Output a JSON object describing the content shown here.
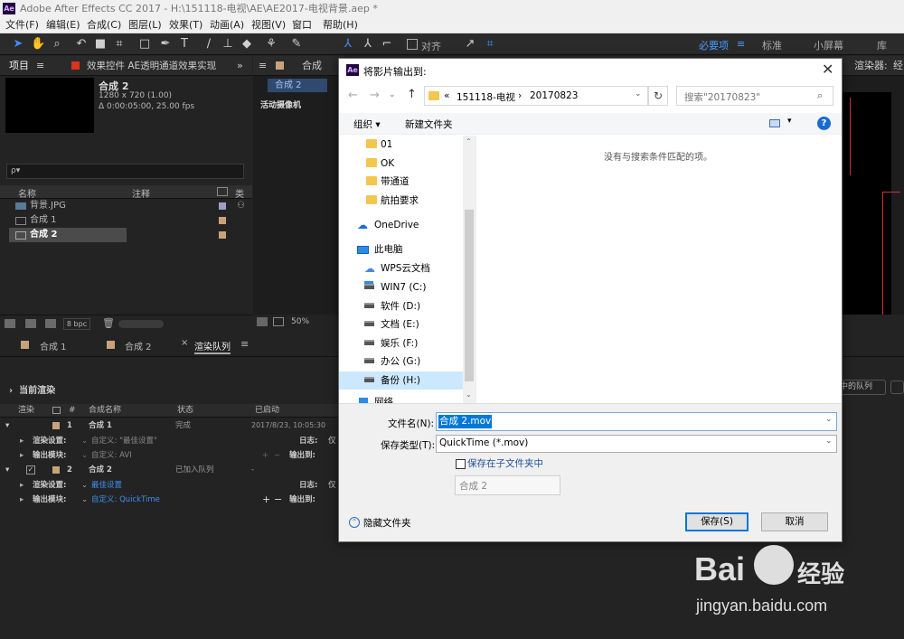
{
  "window": {
    "title": "Adobe After Effects CC 2017 - H:\\151118-电视\\AE\\AE2017-电视背景.aep *",
    "logo": "Ae"
  },
  "menu": [
    "文件(F)",
    "编辑(E)",
    "合成(C)",
    "图层(L)",
    "效果(T)",
    "动画(A)",
    "视图(V)",
    "窗口",
    "帮助(H)"
  ],
  "toolbar": {
    "align_label": "对齐",
    "workspaces": [
      "必要项",
      "标准",
      "小屏幕",
      "库"
    ]
  },
  "project": {
    "tab": "项目",
    "tab2": "效果控件 AE透明通道效果实现",
    "selected_name": "合成 2",
    "selected_info": "1280 x 720 (1.00)",
    "selected_duration": "Δ 0:00:05:00, 25.00 fps",
    "search_placeholder": "ρ▾",
    "columns": [
      "名称",
      "注释",
      "类"
    ],
    "items": [
      {
        "name": "背景.JPG",
        "color": "#9d9dcf"
      },
      {
        "name": "合成 1",
        "color": "#c8a37a"
      },
      {
        "name": "合成 2",
        "color": "#c8a37a"
      }
    ],
    "bpc": "8 bpc"
  },
  "composition": {
    "tab": "合成",
    "tab_label": "合成 2",
    "camera": "活动摄像机",
    "zoom": "50%",
    "renderer": "渲染器:",
    "renderer_value": "经"
  },
  "timeline": {
    "tabs": [
      "合成 1",
      "合成 2",
      "渲染队列"
    ],
    "current_render": "当前渲染",
    "queue_btn": "中的队列",
    "columns": [
      "渲染",
      "#",
      "合成名称",
      "状态",
      "已启动"
    ],
    "items": [
      {
        "num": "1",
        "name": "合成 1",
        "status": "完成",
        "started": "2017/8/23, 10:05:30",
        "log": "日志:",
        "log_val": "仅",
        "render_label": "渲染设置:",
        "render_val": "自定义: \"最佳设置\"",
        "output_label": "输出模块:",
        "output_val": "自定义: AVI",
        "output_to": "输出到:"
      },
      {
        "num": "2",
        "name": "合成 2",
        "status": "已加入队列",
        "started": "-",
        "log": "日志:",
        "log_val": "仅",
        "render_label": "渲染设置:",
        "render_val": "最佳设置",
        "output_label": "输出模块:",
        "output_val": "自定义: QuickTime",
        "output_to": "输出到:"
      }
    ]
  },
  "dialog": {
    "title": "将影片输出到:",
    "logo": "Ae",
    "breadcrumb": [
      "«",
      "151118-电视",
      "›",
      "20170823"
    ],
    "search_placeholder": "搜索\"20170823\"",
    "organize": "组织 ▾",
    "new_folder": "新建文件夹",
    "empty_message": "没有与搜索条件匹配的项。",
    "tree": [
      {
        "label": "01",
        "type": "folder"
      },
      {
        "label": "OK",
        "type": "folder"
      },
      {
        "label": "带通道",
        "type": "folder"
      },
      {
        "label": "航拍要求",
        "type": "folder"
      },
      {
        "label": "OneDrive",
        "type": "cloud"
      },
      {
        "label": "此电脑",
        "type": "pc"
      },
      {
        "label": "WPS云文档",
        "type": "cloud2"
      },
      {
        "label": "WIN7 (C:)",
        "type": "drive"
      },
      {
        "label": "软件 (D:)",
        "type": "drive"
      },
      {
        "label": "文档 (E:)",
        "type": "drive"
      },
      {
        "label": "娱乐 (F:)",
        "type": "drive"
      },
      {
        "label": "办公 (G:)",
        "type": "drive"
      },
      {
        "label": "备份 (H:)",
        "type": "drive"
      },
      {
        "label": "网络",
        "type": "net"
      }
    ],
    "filename_label": "文件名(N):",
    "filename_value": "合成 2.mov",
    "filetype_label": "保存类型(T):",
    "filetype_value": "QuickTime (*.mov)",
    "subfolder_label": "保存在子文件夹中",
    "subfolder_value": "合成 2",
    "hide_folders": "隐藏文件夹",
    "save": "保存(S)",
    "cancel": "取消"
  },
  "watermark": {
    "text": "Bai",
    "text2": "经验",
    "url": "jingyan.baidu.com"
  }
}
